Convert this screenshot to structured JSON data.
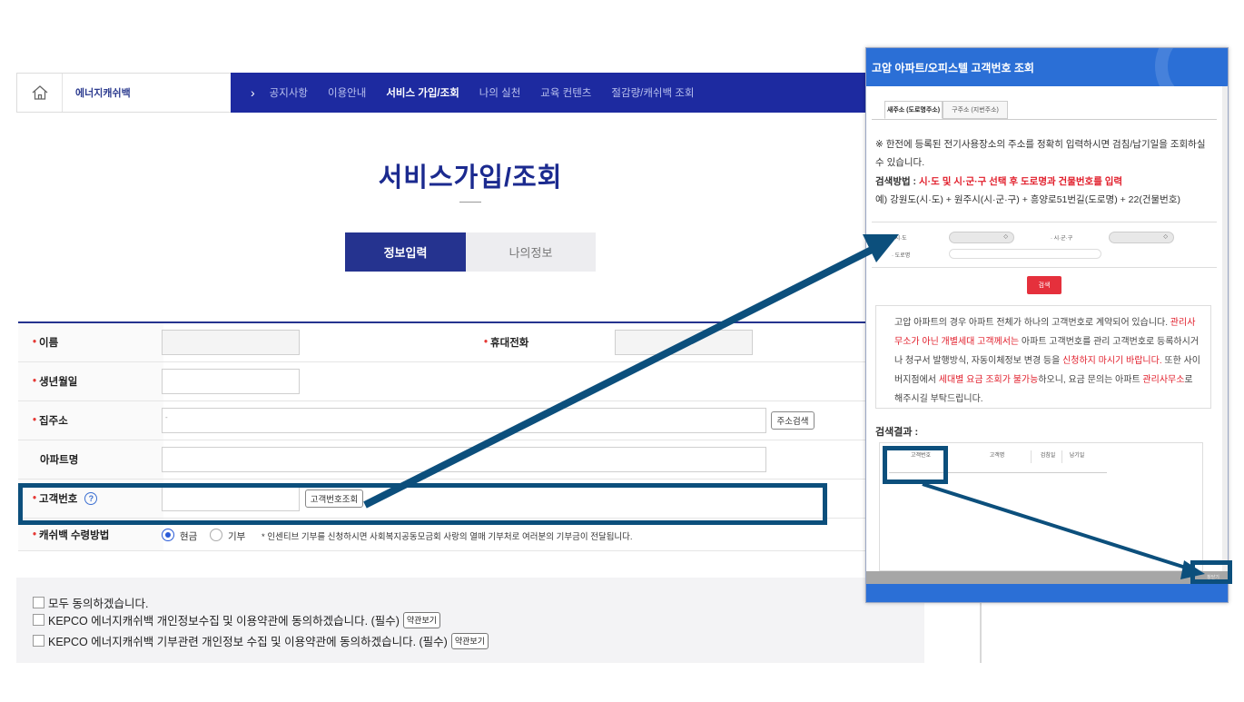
{
  "header": {
    "brand": "에너지캐쉬백",
    "nav": [
      "공지사항",
      "이용안내",
      "서비스 가입/조회",
      "나의 실천",
      "교육 컨텐츠",
      "절감량/캐쉬백 조회"
    ],
    "active_nav": "서비스 가입/조회"
  },
  "page": {
    "title": "서비스가입/조회",
    "tabs": [
      "정보입력",
      "나의정보"
    ]
  },
  "form": {
    "name_label": "이름",
    "mobile_label": "휴대전화",
    "birth_label": "생년월일",
    "address_label": "집주소",
    "address_search_button": "주소검색",
    "address_value": "-",
    "apartment_label": "아파트명",
    "customer_no_label": "고객번호",
    "customer_lookup_button": "고객번호조회",
    "cashback_method_label": "캐쉬백 수령방법",
    "option_cash": "현금",
    "option_donation": "기부",
    "donation_note": "* 인센티브 기부를 신청하시면 사회복지공동모금회 사랑의 열매 기부처로 여러분의 기부금이 전달됩니다."
  },
  "agreements": {
    "all": "모두 동의하겠습니다.",
    "privacy": "KEPCO 에너지캐쉬백 개인정보수집 및 이용약관에 동의하겠습니다. (필수)",
    "donation": "KEPCO 에너지캐쉬백 기부관련 개인정보 수집 및 이용약관에 동의하겠습니다. (필수)",
    "view_terms": "약관보기"
  },
  "popup": {
    "title": "고압 아파트/오피스텔 고객번호 조회",
    "tabs": [
      "새주소 (도로명주소)",
      "구주소 (지번주소)"
    ],
    "intro": "※ 한전에 등록된 전기사용장소의 주소를 정확히 입력하시면 검침/납기일을 조회하실 수 있습니다.",
    "method_label": "검색방법 :",
    "method_text": "시·도 및 시·군·구 선택 후 도로명과 건물번호를 입력",
    "example": "예) 강원도(시·도) + 원주시(시·군·구) + 흥양로51번길(도로명) + 22(건물번호)",
    "sido_label": "· 시·도",
    "sigungu_label": "· 시·군·구",
    "road_label": "· 도로명",
    "search_button": "검색",
    "notice": {
      "p1": "고압 아파트의 경우 아파트 전체가 하나의 고객번호로 계약되어 있습니다. ",
      "r1": "관리사무소가 아닌 개별세대 고객께서는",
      "p2": " 아파트 고객번호를 관리 고객번호로 등록하시거나 청구서 발행방식, 자동이체정보 변경 등을 ",
      "r2": "신청하지 마시기 바랍니다.",
      "p3": " 또한 사이버지점에서 ",
      "r3": "세대별 요금 조회가 불가능",
      "p4": "하오니, 요금 문의는 아파트 ",
      "r4": "관리사무소",
      "p5": "로 해주시길 부탁드립니다."
    },
    "results_label": "검색결과 :",
    "result_columns": [
      "고객번호",
      "고객명",
      "검침일",
      "납기일"
    ],
    "close_button": "창닫기"
  },
  "colors": {
    "nav_bg": "#1d2aa0",
    "brand_blue": "#25338f",
    "popup_blue": "#2b6fd6",
    "highlight": "#0c4f7c",
    "required_red": "#e53935"
  }
}
